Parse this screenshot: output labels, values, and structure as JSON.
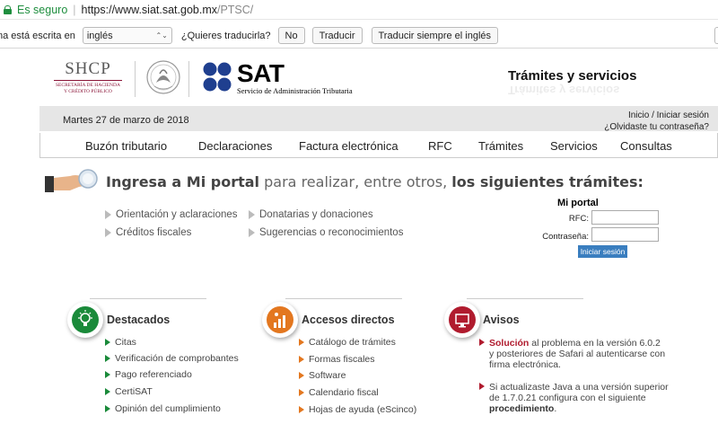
{
  "browser": {
    "secure_label": "Es seguro",
    "url_host": "https://www.siat.sat.gob.mx",
    "url_path": "/PTSC/"
  },
  "translate_bar": {
    "message": "na está escrita en",
    "language": "inglés",
    "question": "¿Quieres traducirla?",
    "no_label": "No",
    "translate_label": "Traducir",
    "always_label": "Traducir siempre el inglés"
  },
  "header": {
    "shcp_title": "SHCP",
    "shcp_sub_1": "SECRETARÍA DE HACIENDA",
    "shcp_sub_2": "Y CRÉDITO PÚBLICO",
    "sat_title": "SAT",
    "sat_subtitle": "Servicio de Administración Tributaria",
    "section_title": "Trámites y servicios"
  },
  "datebar": {
    "date": "Martes 27 de marzo de 2018",
    "login_link": "Inicio / Iniciar sesión",
    "forgot_link": "¿Olvidaste tu contraseña?"
  },
  "menu": [
    "Buzón tributario",
    "Declaraciones",
    "Factura electrónica",
    "RFC",
    "Trámites",
    "Servicios",
    "Consultas"
  ],
  "portal": {
    "headline_b1": "Ingresa a Mi portal",
    "headline_mid": " para realizar, entre otros, ",
    "headline_b2": "los siguientes trámites:",
    "links": [
      "Orientación y aclaraciones",
      "Donatarias y donaciones",
      "Créditos fiscales",
      "Sugerencias o reconocimientos"
    ],
    "login": {
      "title": "Mi portal",
      "rfc_label": "RFC:",
      "password_label": "Contraseña:",
      "button": "Iniciar sesión"
    }
  },
  "destacados": {
    "title": "Destacados",
    "items": [
      "Citas",
      "Verificación de comprobantes",
      "Pago referenciado",
      "CertiSAT",
      "Opinión del cumplimiento"
    ]
  },
  "accesos": {
    "title": "Accesos directos",
    "items": [
      "Catálogo de trámites",
      "Formas fiscales",
      "Software",
      "Calendario fiscal",
      "Hojas de ayuda (eScinco)"
    ]
  },
  "avisos": {
    "title": "Avisos",
    "a1_bold": "Solución",
    "a1_rest": " al problema en la versión 6.0.2",
    "a1_line2": "y posteriores de Safari al autenticarse con",
    "a1_line3": "firma electrónica.",
    "a2_line1": "Si actualizaste Java a una versión superior",
    "a2_line2": "de 1.7.0.21 configura con el siguiente ",
    "a2_bold": "procedimiento",
    "a2_end": "."
  },
  "colors": {
    "green": "#1a8a3a",
    "orange": "#e3771f",
    "red": "#b01b2e",
    "button_blue": "#3a7ebf"
  }
}
